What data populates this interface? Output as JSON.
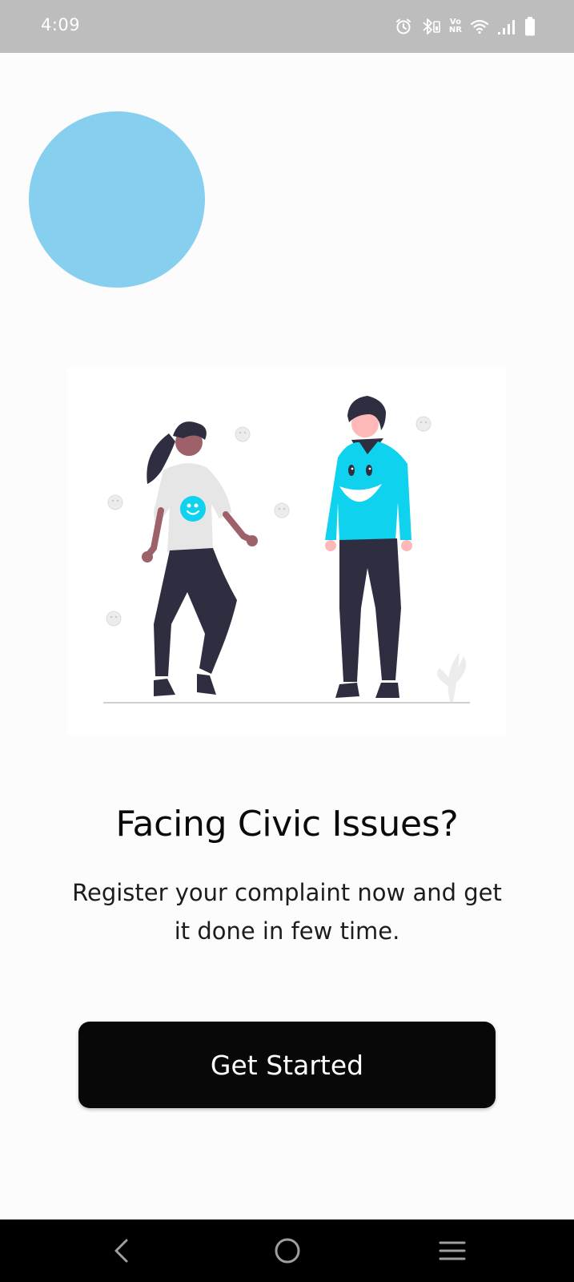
{
  "status_bar": {
    "time": "4:09",
    "icons": [
      "alarm-icon",
      "bluetooth-icon",
      "volte-icon",
      "wifi-icon",
      "signal-icon",
      "battery-icon"
    ],
    "volte_line1": "Vo",
    "volte_line2": "NR"
  },
  "colors": {
    "status_bar": "#bdbdbd",
    "background": "#fcfcfd",
    "circle": "#87cfef",
    "button": "#080808",
    "accent_shirt": "#0fd2ef"
  },
  "illustration": {
    "icon": "two-people-illustration"
  },
  "main": {
    "headline": "Facing Civic Issues?",
    "subtext": "Register your complaint now and get it done in few time.",
    "cta_label": "Get Started"
  },
  "nav_bar": {
    "icons": [
      "back-icon",
      "home-icon",
      "recents-icon"
    ]
  }
}
